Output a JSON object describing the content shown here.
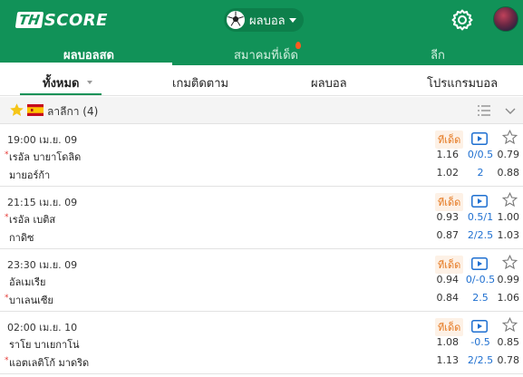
{
  "header": {
    "logo_prefix": "TH",
    "logo_text": "SCORE",
    "sport_label": "ผลบอล"
  },
  "nav": {
    "tabs": [
      {
        "label": "ผลบอลสด",
        "active": true
      },
      {
        "label": "สมาคมที่เด็ด",
        "active": false
      },
      {
        "label": "ลีก",
        "active": false
      }
    ]
  },
  "subtabs": [
    {
      "label": "ทั้งหมด",
      "active": true
    },
    {
      "label": "เกมติดตาม",
      "active": false
    },
    {
      "label": "ผลบอล",
      "active": false
    },
    {
      "label": "โปรแกรมบอล",
      "active": false
    }
  ],
  "league": {
    "name": "ลาลีกา (4)",
    "flag": "spain-flag"
  },
  "matches": [
    {
      "time": "19:00 เม.ย. 09",
      "tip": "ทีเด็ด",
      "home": "เรอัล บายาโดลิด",
      "away": "มายอร์ก้า",
      "home_odd": "1.16",
      "handicap": "0/0.5",
      "home_odd2": "0.79",
      "away_odd": "1.02",
      "total": "2",
      "away_odd2": "0.88",
      "home_marked": true,
      "away_marked": false
    },
    {
      "time": "21:15 เม.ย. 09",
      "tip": "ทีเด็ด",
      "home": "เรอัล เบติส",
      "away": "กาดิซ",
      "home_odd": "0.93",
      "handicap": "0.5/1",
      "home_odd2": "1.00",
      "away_odd": "0.87",
      "total": "2/2.5",
      "away_odd2": "1.03",
      "home_marked": true,
      "away_marked": false
    },
    {
      "time": "23:30 เม.ย. 09",
      "tip": "ทีเด็ด",
      "home": "อัลเมเรีย",
      "away": "บาเลนเซีย",
      "home_odd": "0.94",
      "handicap": "0/-0.5",
      "home_odd2": "0.99",
      "away_odd": "0.84",
      "total": "2.5",
      "away_odd2": "1.06",
      "home_marked": false,
      "away_marked": true
    },
    {
      "time": "02:00 เม.ย. 10",
      "tip": "ทีเด็ด",
      "home": "ราโย บาเยกาโน่",
      "away": "แอตเลติโก้ มาดริด",
      "home_odd": "1.08",
      "handicap": "-0.5",
      "home_odd2": "0.85",
      "away_odd": "1.13",
      "total": "2/2.5",
      "away_odd2": "0.78",
      "home_marked": false,
      "away_marked": true
    }
  ],
  "colors": {
    "brand_green": "#119258",
    "tip_orange": "#e5771e",
    "handicap_blue": "#1e6fd0",
    "mark_red": "#e53935",
    "star_gold": "#f5c518"
  }
}
